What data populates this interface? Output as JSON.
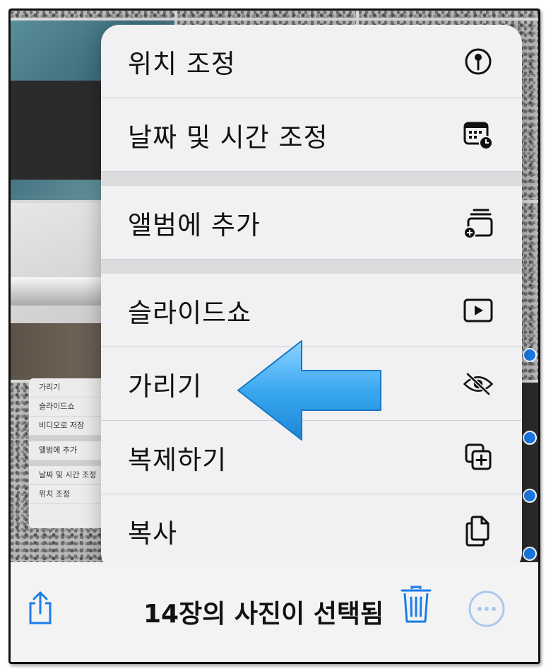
{
  "context_menu": {
    "items": [
      {
        "label": "위치 조정",
        "icon": "location-pin-icon"
      },
      {
        "label": "날짜 및 시간 조정",
        "icon": "calendar-clock-icon"
      },
      {
        "label": "앨범에 추가",
        "icon": "add-to-album-icon"
      },
      {
        "label": "슬라이드쇼",
        "icon": "play-icon"
      },
      {
        "label": "가리기",
        "icon": "eye-slash-icon"
      },
      {
        "label": "복제하기",
        "icon": "duplicate-icon"
      },
      {
        "label": "복사",
        "icon": "copy-icon"
      }
    ]
  },
  "background_menu": {
    "items": [
      "가리기",
      "슬라이드쇼",
      "비디오로 저장",
      "앨범에 추가",
      "날짜 및 시간 조정",
      "위치 조정"
    ]
  },
  "toolbar": {
    "selection_text": "14장의 사진이 선택됨",
    "share_icon": "share-icon",
    "trash_icon": "trash-icon",
    "more_icon": "more-icon"
  },
  "colors": {
    "accent": "#1b7ce8",
    "arrow": "#3aa8f0"
  }
}
